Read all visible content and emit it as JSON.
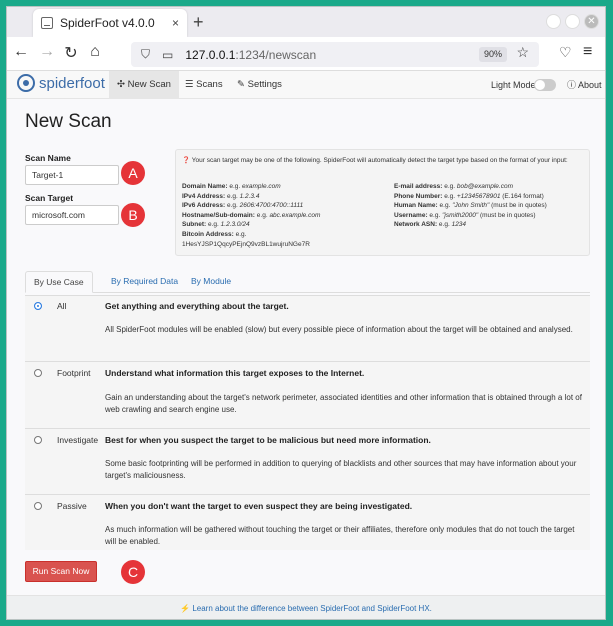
{
  "browser": {
    "tab_title": "SpiderFoot v4.0.0",
    "tab_close": "×",
    "new_tab": "+",
    "url_host": "127.0.0.1",
    "url_path": ":1234/newscan",
    "zoom": "90%"
  },
  "app": {
    "logo": "spiderfoot",
    "nav": [
      "New Scan",
      "Scans",
      "Settings"
    ],
    "light_mode": "Light Mode",
    "about": "About"
  },
  "page": {
    "title": "New Scan",
    "scan_name_label": "Scan Name",
    "scan_name_value": "Target-1",
    "scan_target_label": "Scan Target",
    "scan_target_value": "microsoft.com",
    "run_button": "Run Scan Now",
    "footer_link": "Learn about the difference between SpiderFoot and SpiderFoot HX."
  },
  "annotations": [
    "A",
    "B",
    "C"
  ],
  "help": {
    "intro": "Your scan target may be one of the following. SpiderFoot will automatically detect the target type based on the format of your input:",
    "left": [
      {
        "k": "Domain Name",
        "v": "e.g. ",
        "ex": "example.com",
        "note": ""
      },
      {
        "k": "IPv4 Address",
        "v": "e.g. ",
        "ex": "1.2.3.4",
        "note": ""
      },
      {
        "k": "IPv6 Address",
        "v": "e.g. ",
        "ex": "2606:4700:4700::1111",
        "note": ""
      },
      {
        "k": "Hostname/Sub-domain",
        "v": "e.g. ",
        "ex": "abc.example.com",
        "note": ""
      },
      {
        "k": "Subnet",
        "v": "e.g. ",
        "ex": "1.2.3.0/24",
        "note": ""
      },
      {
        "k": "Bitcoin Address",
        "v": "e.g.",
        "ex": "",
        "note": ""
      }
    ],
    "bitcoin_example": "1HesYJSP1QqcyPEjnQ9vzBL1wujruNGe7R",
    "right": [
      {
        "k": "E-mail address",
        "v": "e.g. ",
        "ex": "bob@example.com",
        "note": ""
      },
      {
        "k": "Phone Number",
        "v": "e.g. ",
        "ex": "+12345678901",
        "note": " (E.164 format)"
      },
      {
        "k": "Human Name",
        "v": "e.g. ",
        "ex": "\"John Smith\"",
        "note": " (must be in quotes)"
      },
      {
        "k": "Username",
        "v": "e.g. ",
        "ex": "\"jsmith2000\"",
        "note": " (must be in quotes)"
      },
      {
        "k": "Network ASN",
        "v": "e.g. ",
        "ex": "1234",
        "note": ""
      }
    ]
  },
  "tabs": [
    "By Use Case",
    "By Required Data",
    "By Module"
  ],
  "use_cases": [
    {
      "name": "All",
      "summary": "Get anything and everything about the target.",
      "desc": "All SpiderFoot modules will be enabled (slow) but every possible piece of information about the target will be obtained and analysed.",
      "selected": true
    },
    {
      "name": "Footprint",
      "summary": "Understand what information this target exposes to the Internet.",
      "desc": "Gain an understanding about the target's network perimeter, associated identities and other information that is obtained through a lot of web crawling and search engine use.",
      "selected": false
    },
    {
      "name": "Investigate",
      "summary": "Best for when you suspect the target to be malicious but need more information.",
      "desc": "Some basic footprinting will be performed in addition to querying of blacklists and other sources that may have information about your target's maliciousness.",
      "selected": false
    },
    {
      "name": "Passive",
      "summary": "When you don't want the target to even suspect they are being investigated.",
      "desc": "As much information will be gathered without touching the target or their affiliates, therefore only modules that do not touch the target will be enabled.",
      "selected": false
    }
  ]
}
